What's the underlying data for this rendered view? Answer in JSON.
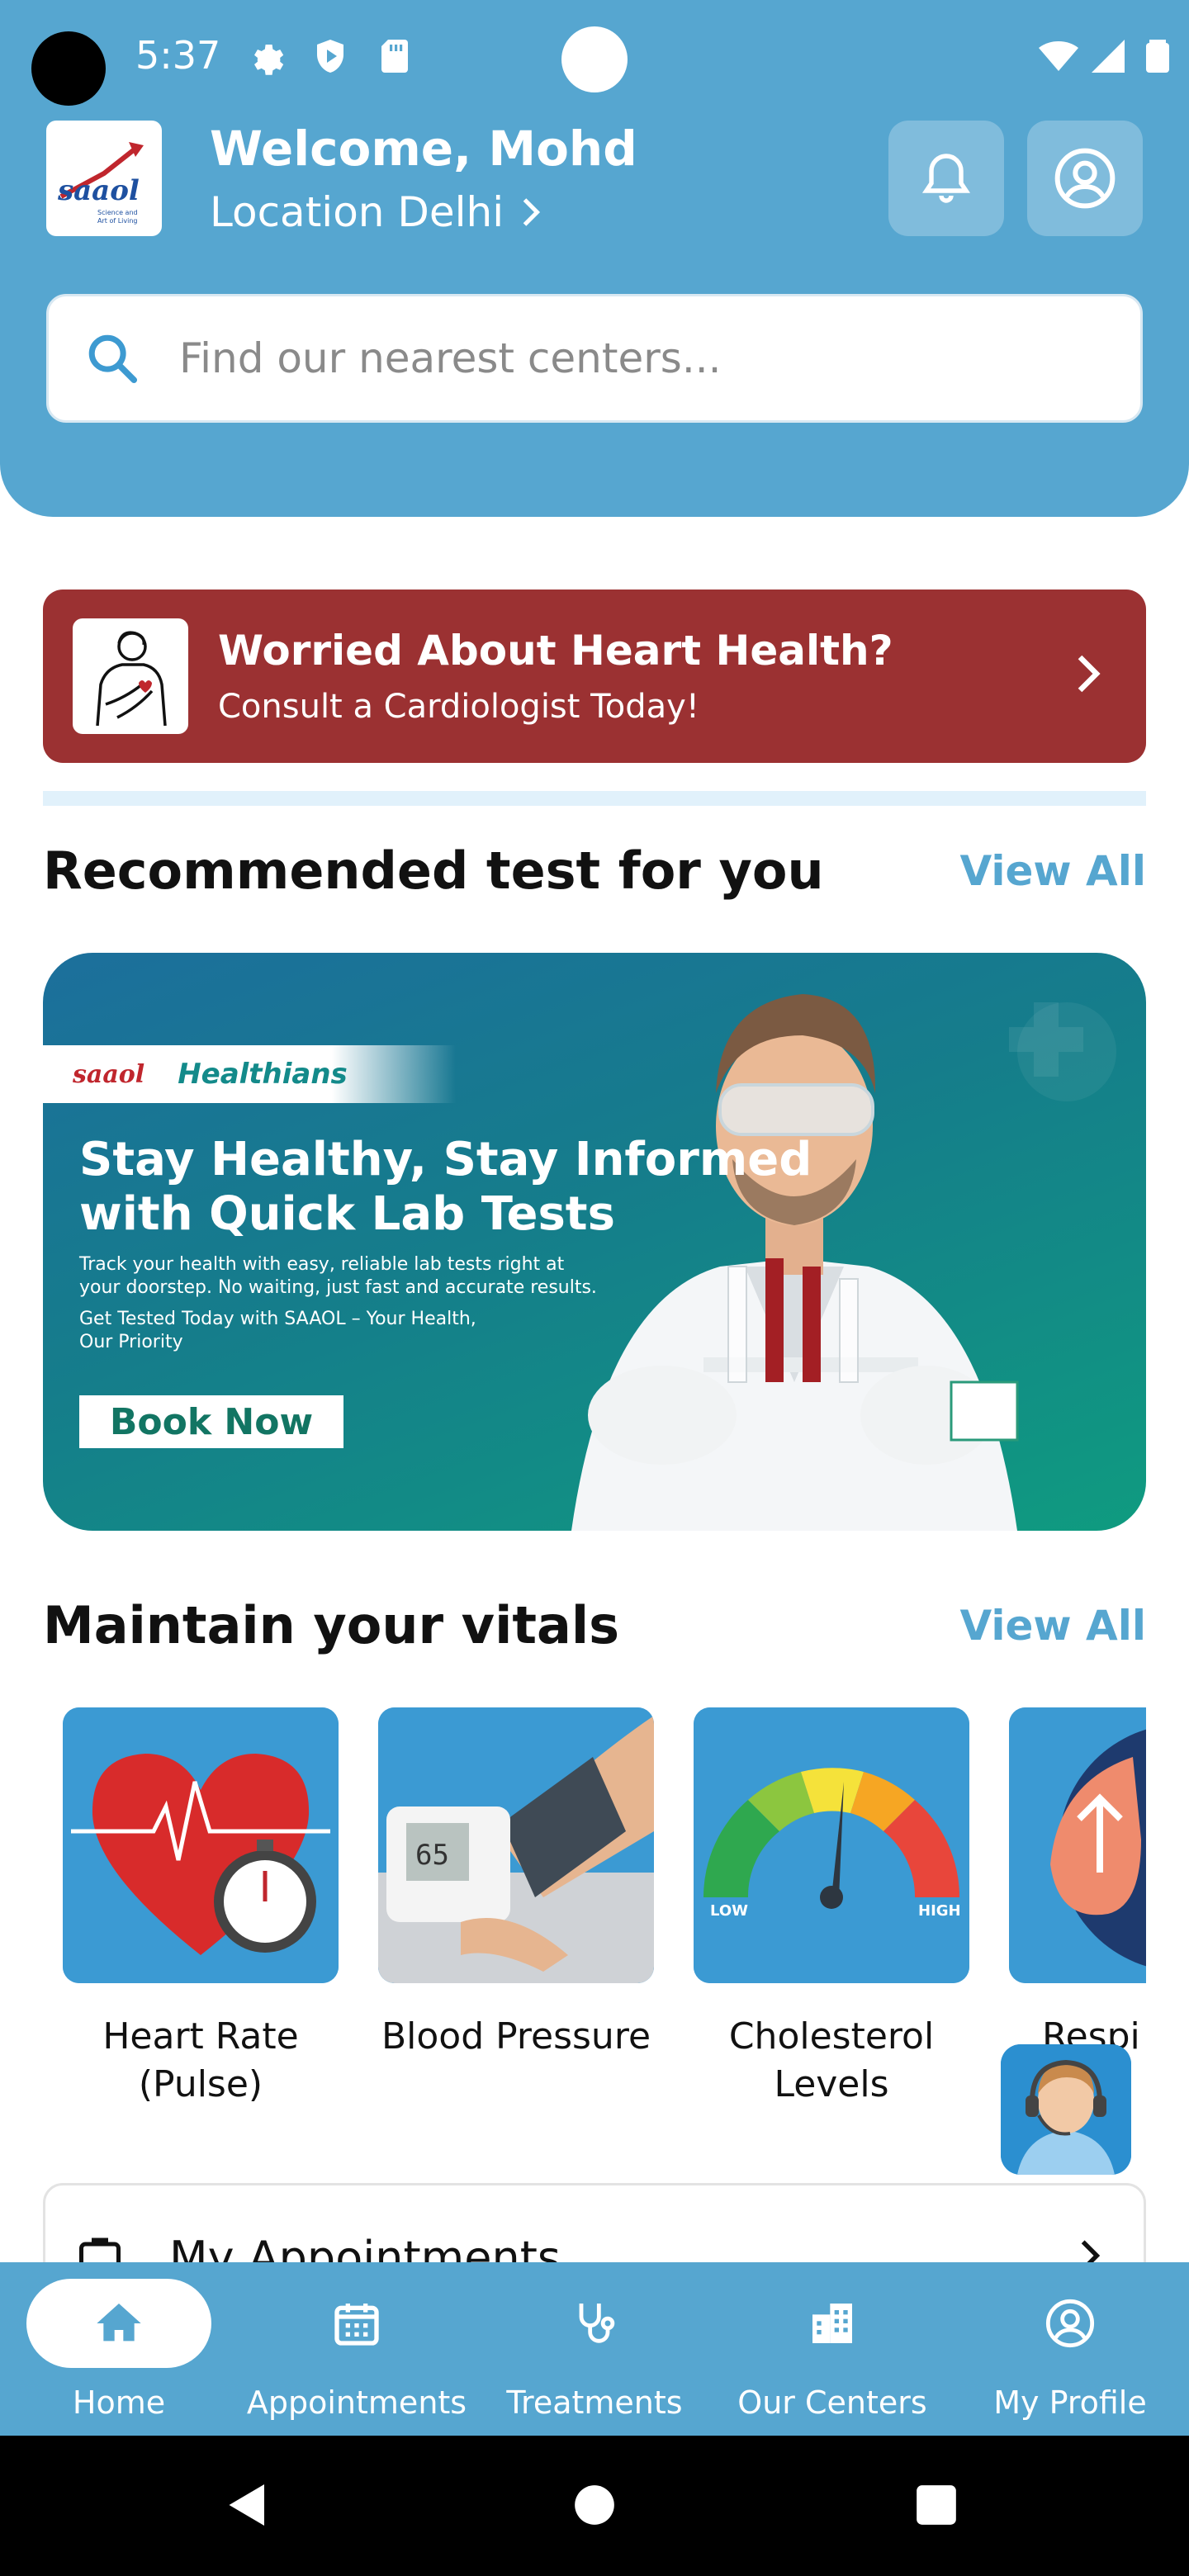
{
  "status_bar": {
    "time": "5:37"
  },
  "header": {
    "welcome": "Welcome, Mohd",
    "location": "Location Delhi",
    "logo_text": "saaol",
    "logo_tagline": "Science and Art of Living"
  },
  "search": {
    "placeholder": "Find our nearest centers..."
  },
  "consult_banner": {
    "title": "Worried About Heart Health?",
    "subtitle": "Consult a Cardiologist Today!"
  },
  "recommended": {
    "title": "Recommended test for you",
    "view_all": "View All",
    "promo": {
      "brand_1": "saaol",
      "brand_2": "Healthians",
      "headline": "Stay Healthy, Stay Informed with Quick Lab Tests",
      "description": "Track your health with easy, reliable lab tests right at your doorstep. No waiting, just fast and accurate results.",
      "tagline": "Get Tested Today with SAAOL – Your Health, Our Priority",
      "cta": "Book Now"
    }
  },
  "vitals": {
    "title": "Maintain your vitals",
    "view_all": "View All",
    "items": [
      {
        "label": "Heart Rate\n(Pulse)"
      },
      {
        "label": "Blood Pressure"
      },
      {
        "label": "Cholesterol\nLevels"
      },
      {
        "label": "Respi"
      }
    ]
  },
  "appointments": {
    "label": "My Appointments"
  },
  "bottom_nav": {
    "items": [
      {
        "label": "Home",
        "icon": "home-icon",
        "active": true
      },
      {
        "label": "Appointments",
        "icon": "calendar-icon",
        "active": false
      },
      {
        "label": "Treatments",
        "icon": "stethoscope-icon",
        "active": false
      },
      {
        "label": "Our Centers",
        "icon": "building-icon",
        "active": false
      },
      {
        "label": "My Profile",
        "icon": "profile-icon",
        "active": false
      }
    ]
  },
  "colors": {
    "primary": "#56a6d0",
    "consult_banner": "#9b3132",
    "promo_teal": "#0f9b80"
  }
}
